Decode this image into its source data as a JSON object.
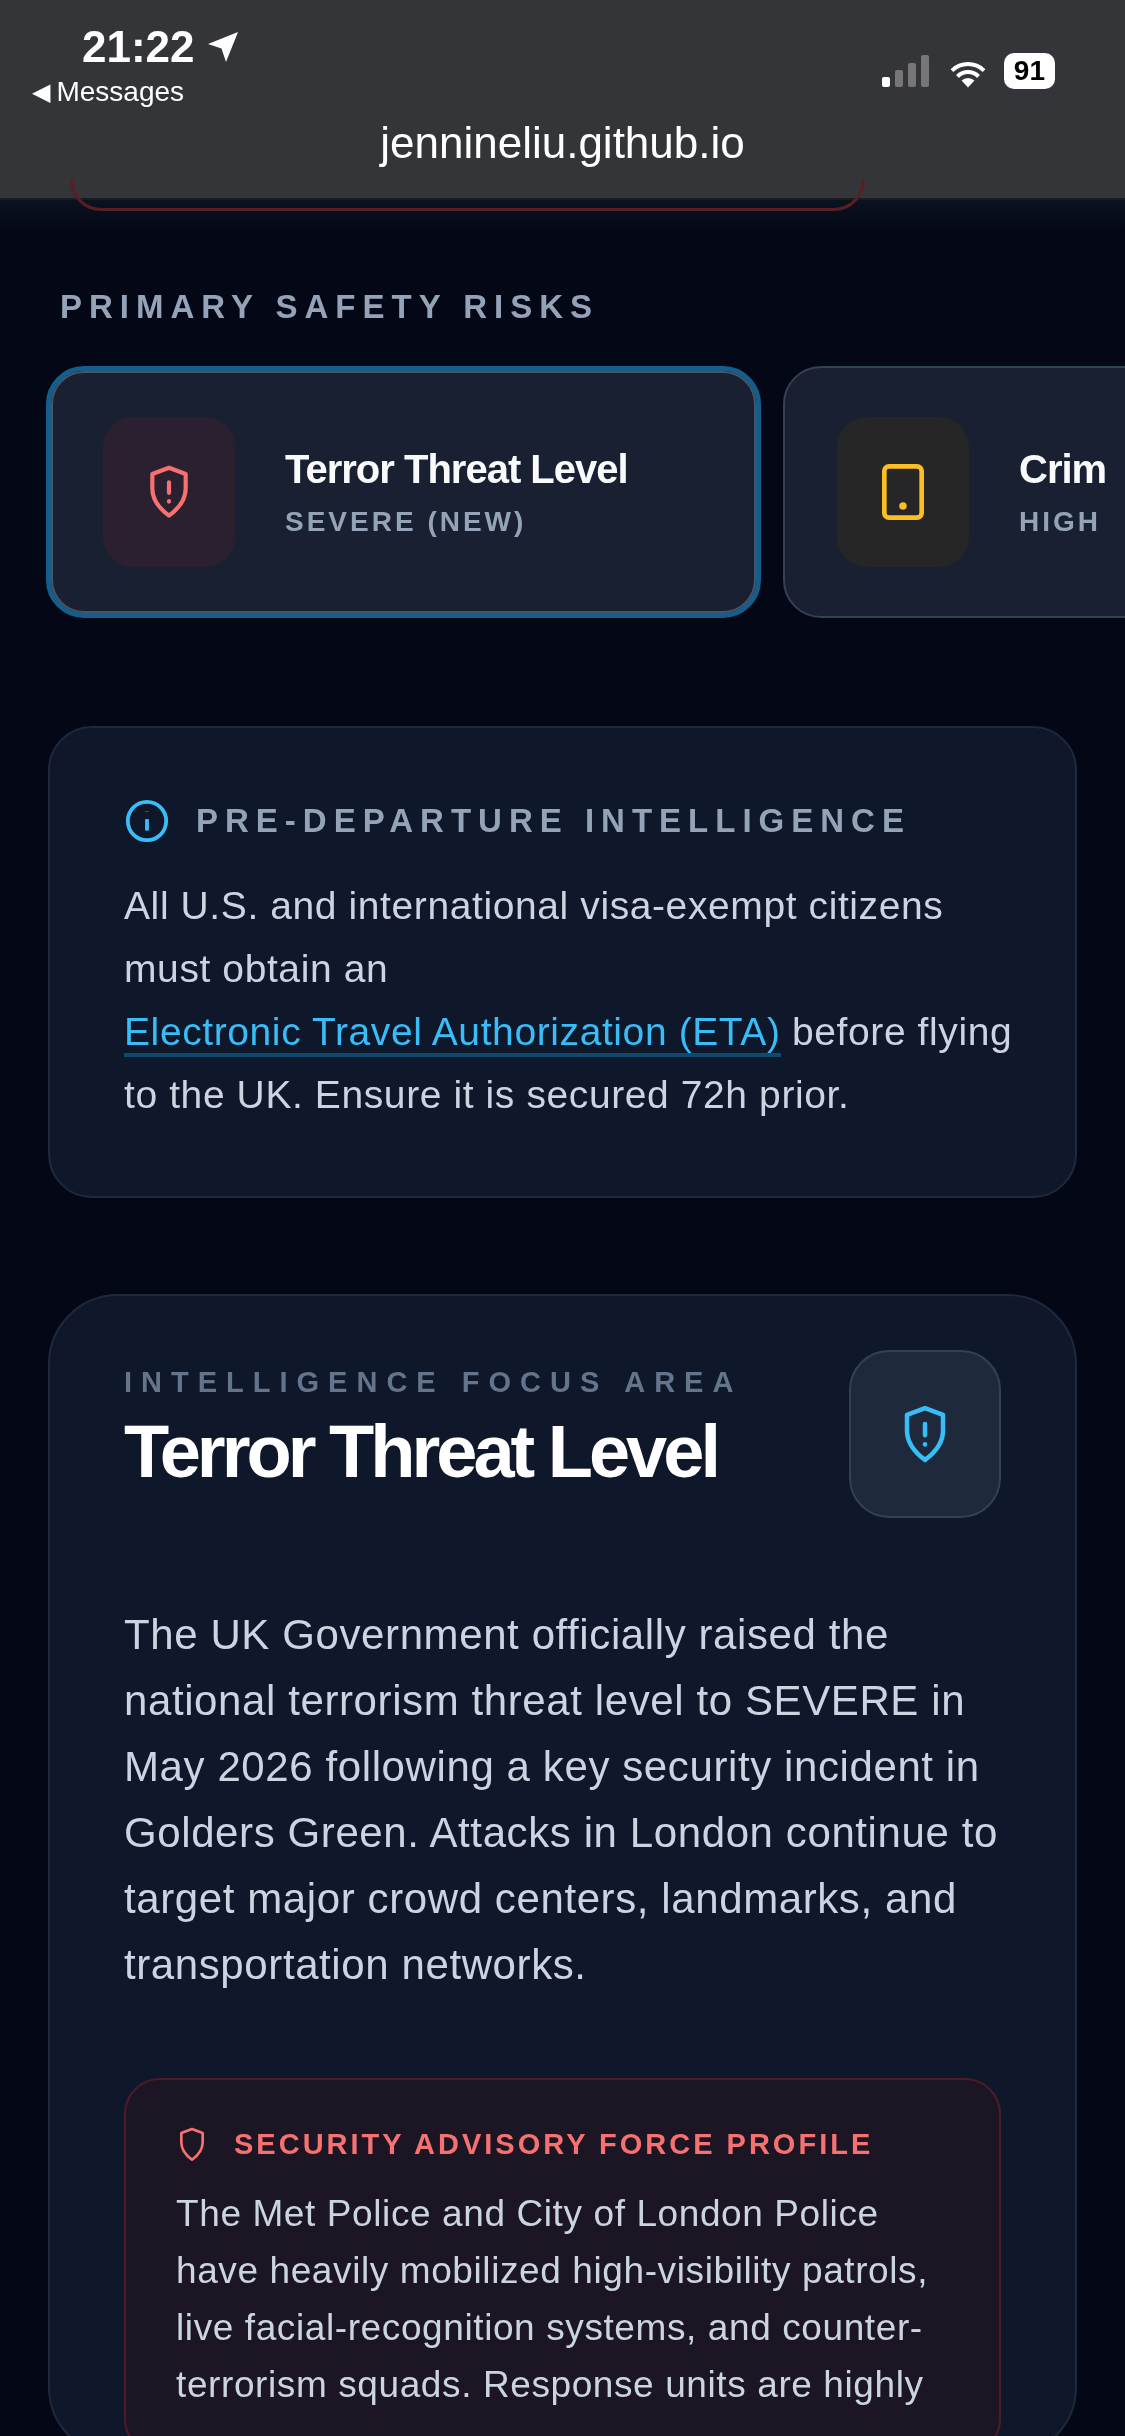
{
  "status_bar": {
    "time": "21:22",
    "back_arrow": "◀",
    "back_label": "Messages",
    "battery": "91"
  },
  "address_bar": {
    "url": "jennineliu.github.io"
  },
  "risks": {
    "heading": "PRIMARY SAFETY RISKS",
    "cards": [
      {
        "title": "Terror Threat Level",
        "subtitle": "SEVERE (NEW)",
        "selected": true,
        "color": "#f87171"
      },
      {
        "title": "Crim",
        "subtitle": "HIGH",
        "selected": false,
        "color": "#fbbf24"
      }
    ]
  },
  "pre_departure": {
    "heading": "PRE-DEPARTURE INTELLIGENCE",
    "text_before": "All U.S. and international visa-exempt citizens must obtain an",
    "link": "Electronic Travel Authorization (ETA)",
    "text_after": "before flying to the UK. Ensure it is secured 72h prior."
  },
  "focus": {
    "eyebrow": "INTELLIGENCE FOCUS AREA",
    "title": "Terror Threat Level",
    "body": "The UK Government officially raised the national terrorism threat level to SEVERE in May 2026 following a key security incident in Golders Green. Attacks in London continue to target major crowd centers, landmarks, and transportation networks.",
    "advisory": {
      "heading": "SECURITY ADVISORY FORCE PROFILE",
      "text": "The Met Police and City of London Police have heavily mobilized high-visibility patrols, live facial-recognition systems, and counter-terrorism squads. Response units are highly"
    }
  }
}
